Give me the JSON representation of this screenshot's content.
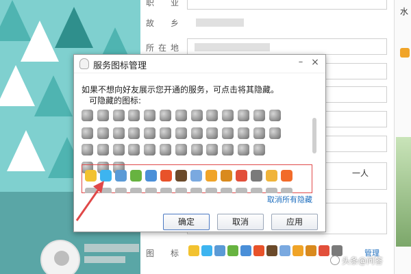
{
  "background_form": {
    "fields": [
      {
        "label": "职　业"
      },
      {
        "label": "故　乡"
      },
      {
        "label": "所在地"
      }
    ],
    "textarea_text": "一人",
    "icons_label": "图　标",
    "manage_link": "管理"
  },
  "right_edge": {
    "text": "水"
  },
  "watermark": {
    "text": "头条@问答"
  },
  "dialog": {
    "title": "服务图标管理",
    "minimize_label": "–",
    "close_label": "×",
    "intro": "如果不想向好友展示您开通的服务，可点击将其隐藏。",
    "hidable_label": "可隐藏的图标:",
    "cancel_all_link": "取消所有隐藏",
    "buttons": {
      "ok": "确定",
      "cancel": "取消",
      "apply": "应用"
    }
  },
  "colors": {
    "highlight_border": "#e04848",
    "arrow": "#e04848",
    "link": "#1f6fbf",
    "sky": "#7fd0cf"
  },
  "icons": {
    "hidden_rows": [
      [
        "heart-icon",
        "bag-icon",
        "diamond-icon",
        "lock-icon",
        "gem-icon",
        "gem-icon",
        "bear-icon",
        "heart-icon",
        "gem-icon",
        "gem-icon",
        "gem-icon",
        "star-icon",
        "gem-icon"
      ],
      [
        "heart-icon",
        "bag-icon",
        "diamond-icon",
        "book-icon",
        "gem-icon",
        "gem-icon",
        "gem-icon",
        "gem-icon",
        "gem-icon",
        "gem-icon",
        "gem-icon",
        "gem-icon",
        "ball-icon"
      ],
      [
        "heart-icon",
        "bag-icon",
        "diamond-icon",
        "gem-icon",
        "gem-icon",
        "crown-icon",
        "gem-icon",
        "gem-icon",
        "gem-icon",
        "music-icon",
        "gem-icon",
        "ball-icon"
      ],
      [
        "key-icon",
        "bag-icon",
        "gem-icon"
      ]
    ],
    "shown": [
      "star-icon",
      "app-icon",
      "photo-icon",
      "gift-icon",
      "eye-icon",
      "puzzle-icon",
      "cow-icon",
      "mail-icon",
      "coin-icon",
      "bear-icon",
      "girl-icon",
      "gem-icon",
      "face-icon",
      "swirl-icon"
    ],
    "shown_colors": [
      "#f2c230",
      "#3db4f0",
      "#5a9ad6",
      "#67b340",
      "#4a8fd8",
      "#e8522a",
      "#6b4a2a",
      "#7aa9e0",
      "#f0a428",
      "#d98a1e",
      "#e24f3a",
      "#7a7a7a",
      "#f0b43a",
      "#f26b2a"
    ]
  }
}
